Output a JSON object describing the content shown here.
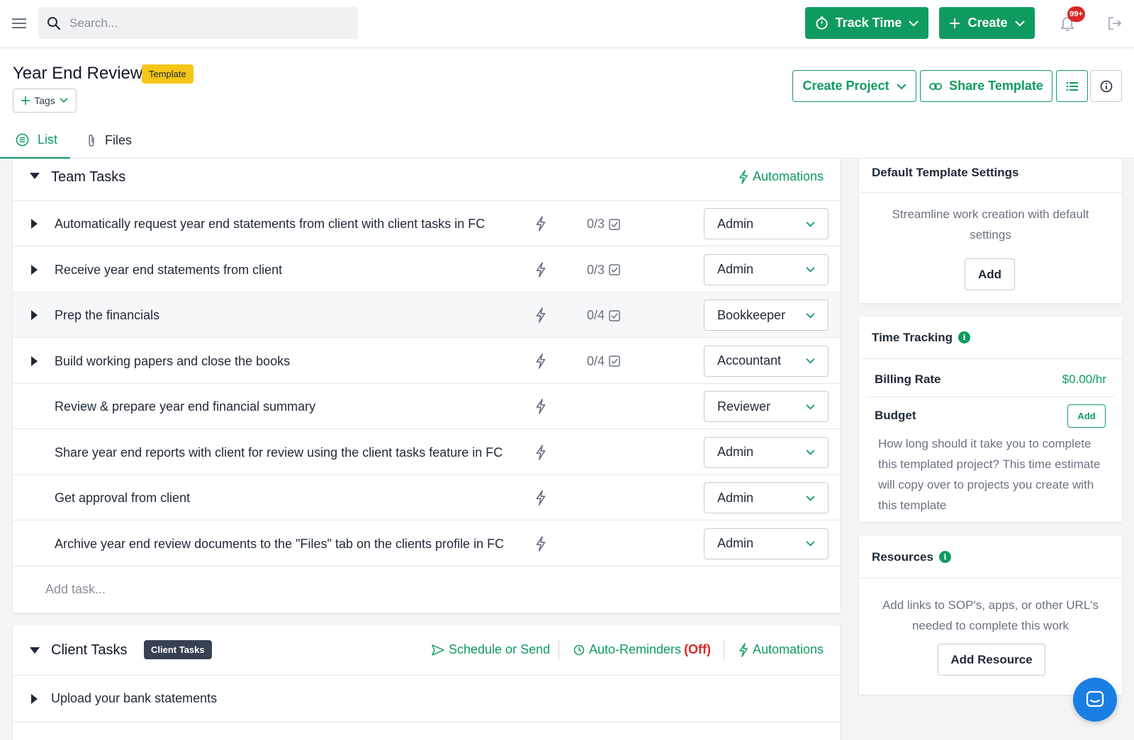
{
  "topbar": {
    "search_placeholder": "Search...",
    "track_time_label": "Track Time",
    "create_label": "Create",
    "notification_count": "99+"
  },
  "header": {
    "title": "Year End Review",
    "badge": "Template",
    "tags_label": "Tags",
    "create_project_label": "Create Project",
    "share_template_label": "Share Template",
    "tabs": [
      {
        "label": "List",
        "active": true
      },
      {
        "label": "Files",
        "active": false
      }
    ]
  },
  "team_tasks": {
    "title": "Team Tasks",
    "automations_label": "Automations",
    "add_task_placeholder": "Add task...",
    "rows": [
      {
        "name": "Automatically request year end statements from client with client tasks in FC",
        "subtasks": "0/3",
        "role": "Admin",
        "expandable": true
      },
      {
        "name": "Receive year end statements from client",
        "subtasks": "0/3",
        "role": "Admin",
        "expandable": true
      },
      {
        "name": "Prep the financials",
        "subtasks": "0/4",
        "role": "Bookkeeper",
        "expandable": true
      },
      {
        "name": "Build working papers and close the books",
        "subtasks": "0/4",
        "role": "Accountant",
        "expandable": true
      },
      {
        "name": "Review & prepare year end financial summary",
        "subtasks": "",
        "role": "Reviewer",
        "expandable": false
      },
      {
        "name": "Share year end reports with client for review using the client tasks feature in FC",
        "subtasks": "",
        "role": "Admin",
        "expandable": false
      },
      {
        "name": "Get approval from client",
        "subtasks": "",
        "role": "Admin",
        "expandable": false
      },
      {
        "name": "Archive year end review documents to the \"Files\" tab on the clients profile in FC",
        "subtasks": "",
        "role": "Admin",
        "expandable": false
      }
    ]
  },
  "client_tasks": {
    "title": "Client Tasks",
    "badge": "Client Tasks",
    "schedule_label": "Schedule or Send",
    "auto_reminders_label": "Auto-Reminders",
    "auto_reminders_state": "(Off)",
    "automations_label": "Automations",
    "rows": [
      {
        "name": "Upload your bank statements"
      }
    ]
  },
  "sidebar": {
    "default_settings": {
      "title": "Default Template Settings",
      "description": "Streamline work creation with default settings",
      "add_label": "Add"
    },
    "time_tracking": {
      "title": "Time Tracking",
      "billing_rate_label": "Billing Rate",
      "billing_rate_value": "$0.00/hr",
      "budget_label": "Budget",
      "budget_add_label": "Add",
      "budget_description": "How long should it take you to complete this templated project? This time estimate will copy over to projects you create with this template"
    },
    "resources": {
      "title": "Resources",
      "description": "Add links to SOP's, apps, or other URL's needed to complete this work",
      "add_label": "Add Resource"
    }
  },
  "colors": {
    "brand_green": "#0f9b5f",
    "template_yellow": "#f5c518",
    "alert_red": "#dc2626",
    "chat_blue": "#1a7fe3"
  }
}
